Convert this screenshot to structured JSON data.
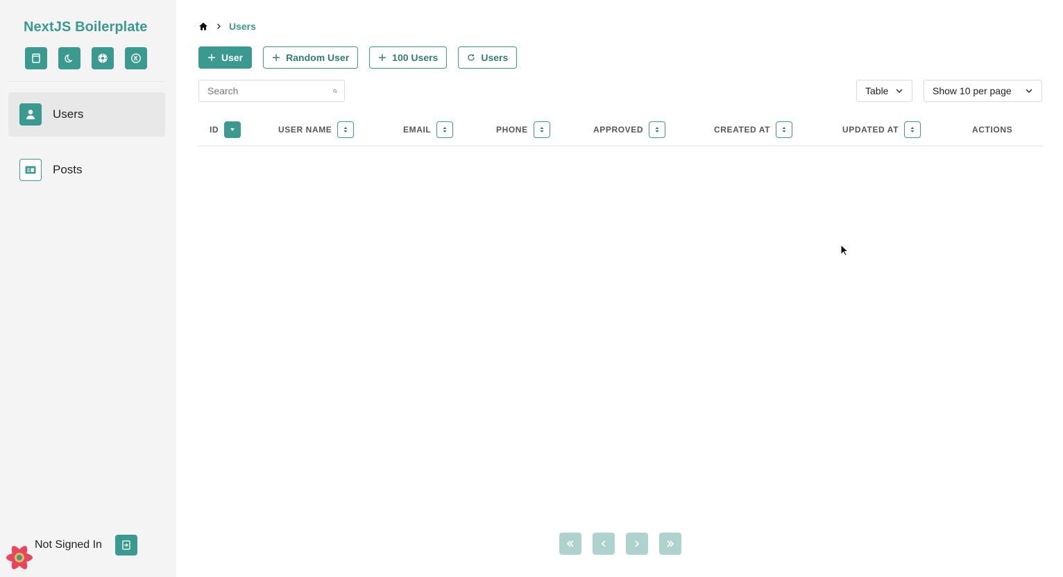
{
  "sidebar": {
    "brand": "NextJS Boilerplate",
    "quick_icons": [
      "layout-icon",
      "moon-icon",
      "settings-icon",
      "k-badge-icon"
    ],
    "items": [
      {
        "label": "Users",
        "icon": "user-icon",
        "active": true
      },
      {
        "label": "Posts",
        "icon": "post-card-icon",
        "active": false
      }
    ],
    "signin": {
      "label": "Not Signed In",
      "icon": "sign-in-icon"
    }
  },
  "breadcrumb": {
    "home_icon": "home-icon",
    "current": "Users"
  },
  "toolbar": {
    "add_user": "User",
    "random_user": "Random User",
    "hundred_users": "100 Users",
    "refresh_users": "Users"
  },
  "search": {
    "placeholder": "Search",
    "value": ""
  },
  "view_select": {
    "value": "Table"
  },
  "per_page_select": {
    "value": "Show 10 per page"
  },
  "table": {
    "columns": [
      "ID",
      "USER NAME",
      "EMAIL",
      "PHONE",
      "APPROVED",
      "CREATED AT",
      "UPDATED AT",
      "ACTIONS"
    ],
    "sort_active": "ID",
    "rows": []
  },
  "pagination": {
    "icons": [
      "first-page-icon",
      "previous-page-icon",
      "next-page-icon",
      "last-page-icon"
    ]
  },
  "colors": {
    "accent": "#3a9a8f",
    "accent_light": "#aed3cf",
    "sidebar_bg": "#f4f4f4"
  }
}
